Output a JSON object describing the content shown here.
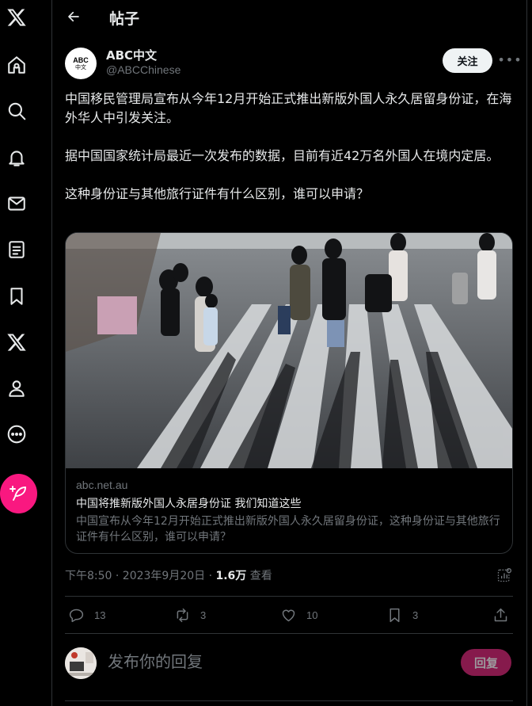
{
  "header": {
    "title": "帖子"
  },
  "author": {
    "avatar_text": "ABC",
    "avatar_subtext": "中文",
    "name": "ABC中文",
    "handle": "@ABCChinese",
    "follow_label": "关注"
  },
  "tweet": {
    "paragraphs": [
      "中国移民管理局宣布从今年12月开始正式推出新版外国人永久居留身份证，在海外华人中引发关注。",
      "据中国国家统计局最近一次发布的数据，目前有近42万名外国人在境内定居。",
      "这种身份证与其他旅行证件有什么区别，谁可以申请？"
    ]
  },
  "card": {
    "domain": "abc.net.au",
    "title": "中国将推新版外国人永居身份证 我们知道这些",
    "description": "中国宣布从今年12月开始正式推出新版外国人永久居留身份证，这种身份证与其他旅行证件有什么区别，谁可以申请？"
  },
  "meta": {
    "time": "下午8:50 · 2023年9月20日 · ",
    "views_count": "1.6万",
    "views_label": " 查看"
  },
  "actions": {
    "replies": "13",
    "reposts": "3",
    "likes": "10",
    "bookmarks": "3"
  },
  "reply": {
    "placeholder": "发布你的回复",
    "button_label": "回复"
  },
  "colors": {
    "background": "#000000",
    "text": "#e7e9ea",
    "muted": "#71767b",
    "border": "#2f3336",
    "compose_accent": "#f91880",
    "reply_button_disabled": "#861a4c"
  }
}
